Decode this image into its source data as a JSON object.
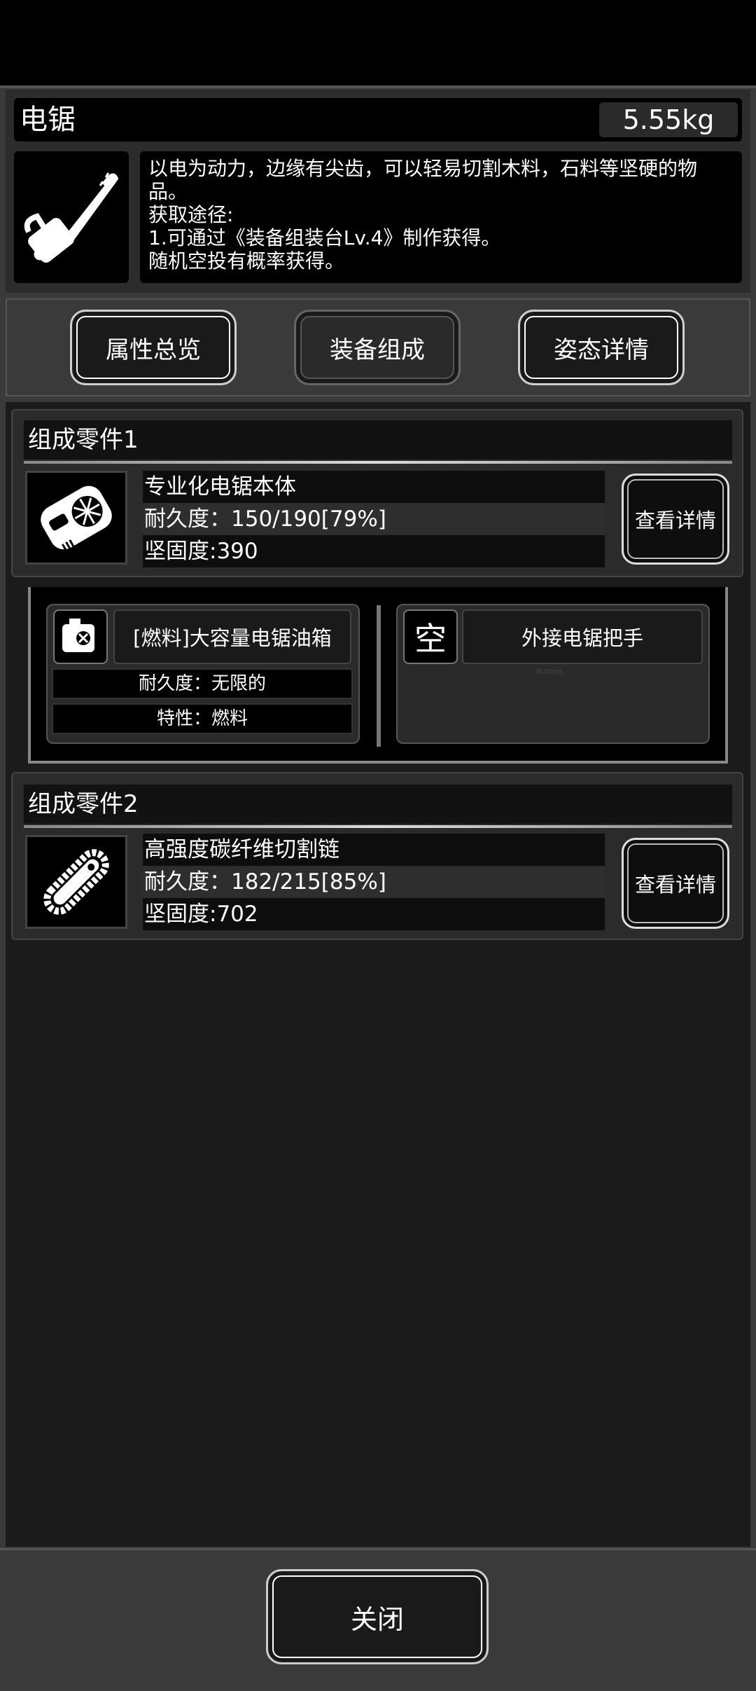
{
  "item": {
    "name": "电锯",
    "weight": "5.55kg",
    "icon": "chainsaw-icon",
    "description_lines": [
      "以电为动力，边缘有尖齿，可以轻易切割木料，石料等坚硬的物",
      "品。",
      "获取途径:",
      "1.可通过《装备组装台Lv.4》制作获得。",
      "随机空投有概率获得。"
    ]
  },
  "tabs": [
    {
      "label": "属性总览"
    },
    {
      "label": "装备组成"
    },
    {
      "label": "姿态详情"
    }
  ],
  "parts": [
    {
      "header": "组成零件1",
      "icon": "chainsaw-body-icon",
      "name": "专业化电锯本体",
      "durability": "耐久度：150/190[79%]",
      "hardness": "坚固度:390",
      "detail_label": "查看详情"
    },
    {
      "header": "组成零件2",
      "icon": "saw-chain-icon",
      "name": "高强度碳纤维切割链",
      "durability": "耐久度：182/215[85%]",
      "hardness": "坚固度:702",
      "detail_label": "查看详情"
    }
  ],
  "subparts": [
    {
      "icon": "fuel-tank-icon",
      "title": "[燃料]大容量电锯油箱",
      "durability": "耐久度：无限的",
      "trait": "特性：燃料"
    },
    {
      "empty_glyph": "空",
      "title": "外接电锯把手",
      "faint_text": "Button"
    }
  ],
  "footer": {
    "close_label": "关闭"
  },
  "colors": {
    "background": "#1b1b1b",
    "panel": "#3a3a3a",
    "text": "#ffffff"
  }
}
